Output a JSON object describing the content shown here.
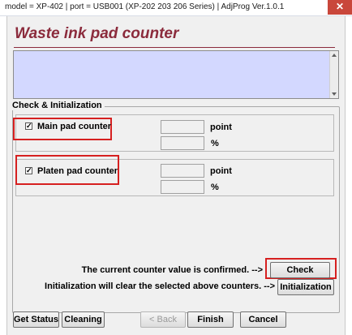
{
  "window": {
    "title": "model = XP-402 | port = USB001 (XP-202 203 206 Series) | AdjProg Ver.1.0.1",
    "close_label": "✕"
  },
  "header": {
    "title": "Waste ink pad counter"
  },
  "check_group": {
    "title": "Check & Initialization",
    "main_pad": {
      "label": "Main pad counter",
      "checked": true,
      "point_value": "",
      "percent_value": "",
      "point_unit": "point",
      "percent_unit": "%"
    },
    "platen_pad": {
      "label": "Platen pad counter",
      "checked": true,
      "point_value": "",
      "percent_value": "",
      "point_unit": "point",
      "percent_unit": "%"
    },
    "confirm_message": "The current counter value is confirmed. -->",
    "init_message": "Initialization will clear the selected above counters. -->",
    "check_button": "Check",
    "initialization_button": "Initialization"
  },
  "footer": {
    "get_status": "Get Status",
    "cleaning": "Cleaning",
    "back": "< Back",
    "finish": "Finish",
    "cancel": "Cancel"
  },
  "colors": {
    "heading": "#8b2b3c",
    "info_box": "#d3d8ff",
    "highlight": "#d62020"
  }
}
